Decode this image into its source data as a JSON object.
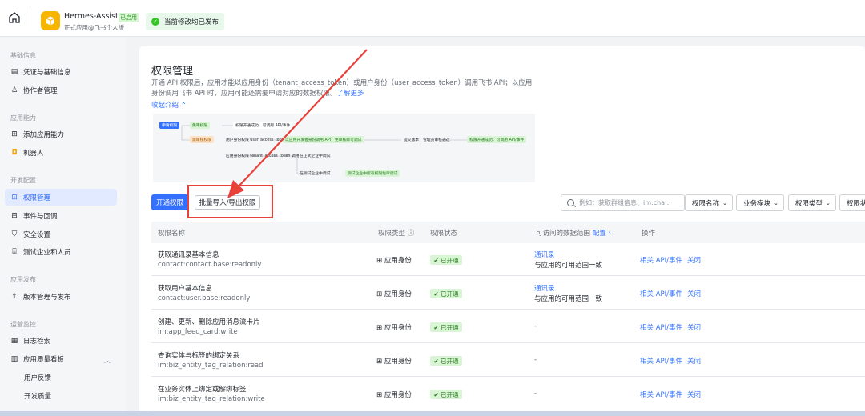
{
  "header": {
    "app_name": "Hermes-Assistant",
    "app_badge": "已启用",
    "app_subtitle": "正式应用@飞书个人版",
    "publish_status": "当前修改均已发布"
  },
  "sidebar": {
    "groups": {
      "basic": "基础信息",
      "capability": "应用能力",
      "dev": "开发配置",
      "release": "应用发布",
      "ops": "运营监控"
    },
    "items": {
      "credentials": "凭证与基础信息",
      "collaborators": "协作者管理",
      "add_capability": "添加应用能力",
      "bot": "机器人",
      "permissions": "权限管理",
      "events": "事件与回调",
      "security": "安全设置",
      "test_tenant": "测试企业和人员",
      "versions": "版本管理与发布",
      "logs": "日志检索",
      "quality": "应用质量看板",
      "feedback": "用户反馈",
      "dev_quality": "开发质量"
    }
  },
  "page": {
    "title": "权限管理",
    "desc": "开通 API 权限后，应用才能以应用身份（tenant_access_token）或用户身份（user_access_token）调用飞书 API；以应用身份调用飞书 API 时，应用可能还需要申请对应的数据权限。",
    "learn_more": "了解更多",
    "collapse": "收起介绍"
  },
  "flow": {
    "start": "申请权限",
    "free": "免审权限",
    "free_result": "权限开通成功，可调用 API/事件",
    "review": "需审核权限",
    "user_identity": "用户身份权限 user_access_token 调用",
    "user_result": "以应用开发者身份调用 API，免审核即可调试",
    "submit": "提交版本，管理员审核通过",
    "final": "权限开通成功，可调用 API/事件",
    "app_identity": "应用身份权限 tenant_access_token 调用",
    "formal": "在正式企业中调试",
    "test": "在测试企业中调试",
    "test_result": "测试企业中所有权限免审调试"
  },
  "toolbar": {
    "open_btn": "开通权限",
    "batch_btn": "批量导入/导出权限",
    "search_placeholder": "例如：获取群组信息、im:cha...",
    "filters": [
      "权限名称",
      "业务模块",
      "权限类型",
      "权限状"
    ]
  },
  "table": {
    "headers": {
      "name": "权限名称",
      "type": "权限类型",
      "status": "权限状态",
      "scope": "可访问的数据范围",
      "scope_link": "配置",
      "actions": "操作"
    },
    "rows": [
      {
        "name": "获取通讯录基本信息",
        "code": "contact:contact.base:readonly",
        "type": "应用身份",
        "status": "已开通",
        "scope1": "通讯录",
        "scope2": "与应用的可用范围一致",
        "act1": "相关 API/事件",
        "act2": "关闭"
      },
      {
        "name": "获取用户基本信息",
        "code": "contact:user.base:readonly",
        "type": "应用身份",
        "status": "已开通",
        "scope1": "通讯录",
        "scope2": "与应用的可用范围一致",
        "act1": "相关 API/事件",
        "act2": "关闭"
      },
      {
        "name": "创建、更新、删除应用消息流卡片",
        "code": "im:app_feed_card:write",
        "type": "应用身份",
        "status": "已开通",
        "scope1": "-",
        "scope2": "",
        "act1": "相关 API/事件",
        "act2": "关闭"
      },
      {
        "name": "查询实体与标签的绑定关系",
        "code": "im:biz_entity_tag_relation:read",
        "type": "应用身份",
        "status": "已开通",
        "scope1": "-",
        "scope2": "",
        "act1": "相关 API/事件",
        "act2": "关闭"
      },
      {
        "name": "在业务实体上绑定或解绑标签",
        "code": "im:biz_entity_tag_relation:write",
        "type": "应用身份",
        "status": "已开通",
        "scope1": "-",
        "scope2": "",
        "act1": "相关 API/事件",
        "act2": "关闭"
      }
    ]
  },
  "colors": {
    "accent": "#3370ff",
    "highlight": "#e8413a",
    "success": "#34c724"
  }
}
